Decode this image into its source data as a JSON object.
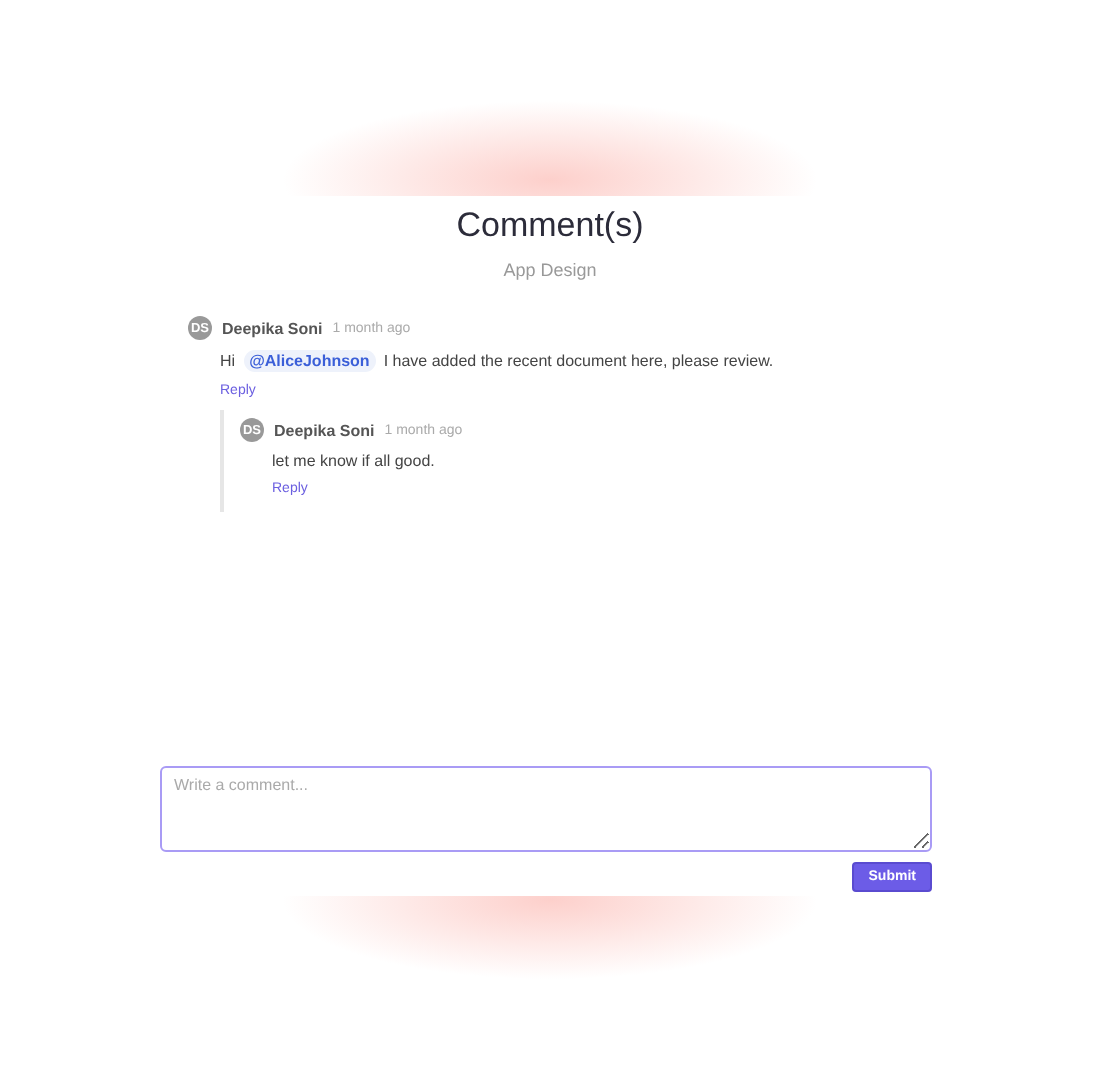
{
  "title": "Comment(s)",
  "subtitle": "App Design",
  "comments": [
    {
      "initials": "DS",
      "author": "Deepika Soni",
      "time": "1 month ago",
      "prefix": "Hi",
      "mention": "@AliceJohnson",
      "text": "I have added the recent document here, please review.",
      "reply": "Reply",
      "children": [
        {
          "initials": "DS",
          "author": "Deepika Soni",
          "time": "1 month ago",
          "text": "let me know if all good.",
          "reply": "Reply"
        }
      ]
    }
  ],
  "composer": {
    "placeholder": "Write a comment...",
    "submit": "Submit"
  }
}
